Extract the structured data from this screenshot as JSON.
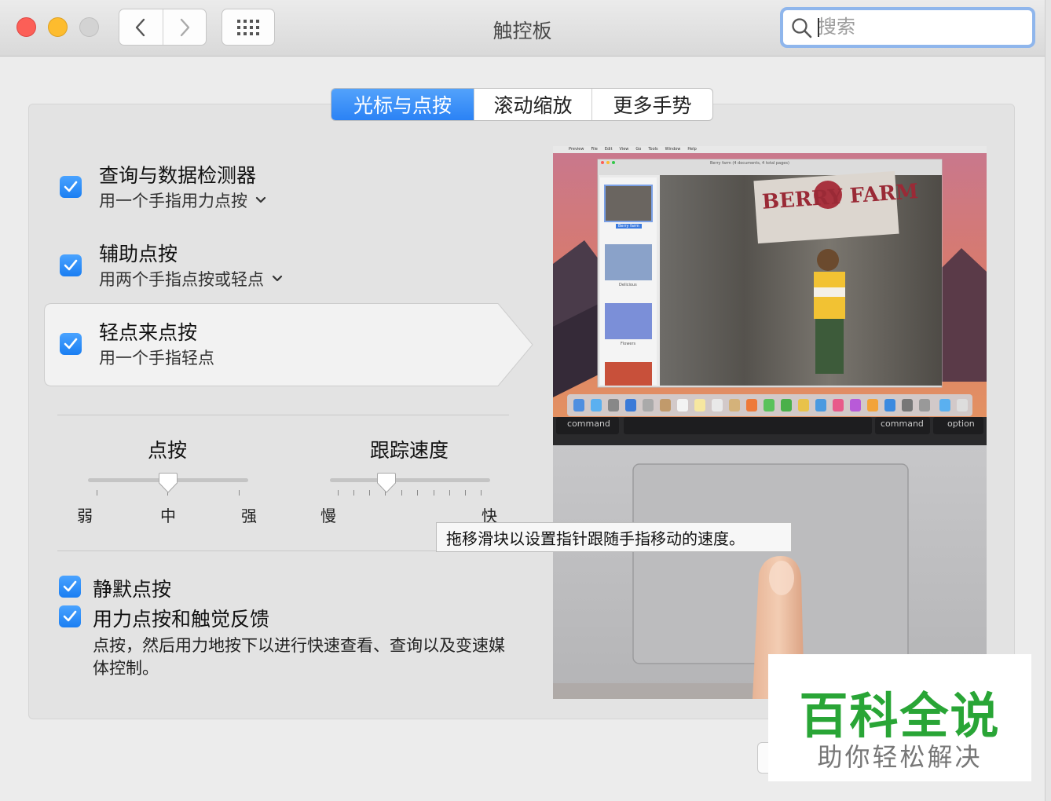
{
  "window": {
    "title": "触控板",
    "search_placeholder": "搜索"
  },
  "tabs": [
    {
      "label": "光标与点按",
      "active": true
    },
    {
      "label": "滚动缩放",
      "active": false
    },
    {
      "label": "更多手势",
      "active": false
    }
  ],
  "options": {
    "lookup": {
      "title": "查询与数据检测器",
      "subtitle": "用一个手指用力点按",
      "checked": true
    },
    "secondary": {
      "title": "辅助点按",
      "subtitle": "用两个手指点按或轻点",
      "checked": true
    },
    "tap": {
      "title": "轻点来点按",
      "subtitle": "用一个手指轻点",
      "checked": true
    }
  },
  "sliders": {
    "click": {
      "title": "点按",
      "labels": [
        "弱",
        "中",
        "强"
      ],
      "value_index": 1,
      "tick_count": 3
    },
    "tracking": {
      "title": "跟踪速度",
      "min_label": "慢",
      "max_label": "快",
      "value_index": 3,
      "tick_count": 10
    }
  },
  "tooltip": "拖移滑块以设置指针跟随手指移动的速度。",
  "bottom_options": {
    "silent": {
      "label": "静默点按",
      "checked": true
    },
    "force": {
      "label": "用力点按和触觉反馈",
      "checked": true,
      "description": "点按，然后用力地按下以进行快速查看、查询以及变速媒体控制。"
    }
  },
  "preview": {
    "menubar": [
      "Preview",
      "File",
      "Edit",
      "View",
      "Go",
      "Tools",
      "Window",
      "Help"
    ],
    "doc_title": "Berry farm (4 documents, 4 total pages)",
    "sidebar_captions": [
      "Berry farm",
      "Delicious",
      "Flowers"
    ],
    "banner_text": "BERRY FARM",
    "key_labels": [
      "command",
      "command",
      "option"
    ]
  },
  "watermark": {
    "main": "百科全说",
    "sub": "助你轻松解决"
  },
  "colors": {
    "accent": "#2b82f5",
    "watermark_green": "#29a536"
  }
}
